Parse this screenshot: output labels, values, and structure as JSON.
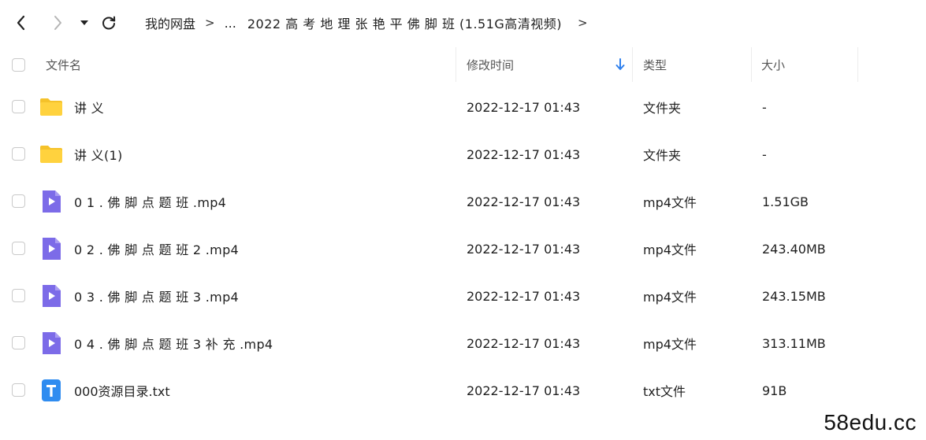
{
  "breadcrumb": {
    "root": "我的网盘",
    "ellipsis": "...",
    "current": "2022 高 考 地 理 张 艳 平 佛 脚 班 (1.51G高清视频)",
    "separator": ">"
  },
  "header": {
    "name": "文件名",
    "modified": "修改时间",
    "type": "类型",
    "size": "大小"
  },
  "files": [
    {
      "icon": "folder-icon",
      "name": "讲 义",
      "modified": "2022-12-17 01:43",
      "type": "文件夹",
      "size": "-"
    },
    {
      "icon": "folder-icon",
      "name": "讲 义(1)",
      "modified": "2022-12-17 01:43",
      "type": "文件夹",
      "size": "-"
    },
    {
      "icon": "video-file-icon",
      "name": "0 1 . 佛 脚 点 题 班 .mp4",
      "modified": "2022-12-17 01:43",
      "type": "mp4文件",
      "size": "1.51GB"
    },
    {
      "icon": "video-file-icon",
      "name": "0 2 . 佛 脚 点 题 班 2 .mp4",
      "modified": "2022-12-17 01:43",
      "type": "mp4文件",
      "size": "243.40MB"
    },
    {
      "icon": "video-file-icon",
      "name": "0 3 . 佛 脚 点 题 班 3 .mp4",
      "modified": "2022-12-17 01:43",
      "type": "mp4文件",
      "size": "243.15MB"
    },
    {
      "icon": "video-file-icon",
      "name": "0 4 . 佛 脚 点 题 班 3 补 充 .mp4",
      "modified": "2022-12-17 01:43",
      "type": "mp4文件",
      "size": "313.11MB"
    },
    {
      "icon": "text-file-icon",
      "name": "000资源目录.txt",
      "modified": "2022-12-17 01:43",
      "type": "txt文件",
      "size": "91B"
    }
  ],
  "watermark": "58edu.cc",
  "colors": {
    "folder": "#FFD23E",
    "folder_tab": "#F5C22A",
    "video": "#7C6BE8",
    "text_file": "#2F8CF0",
    "sort_arrow": "#2F80ED"
  }
}
